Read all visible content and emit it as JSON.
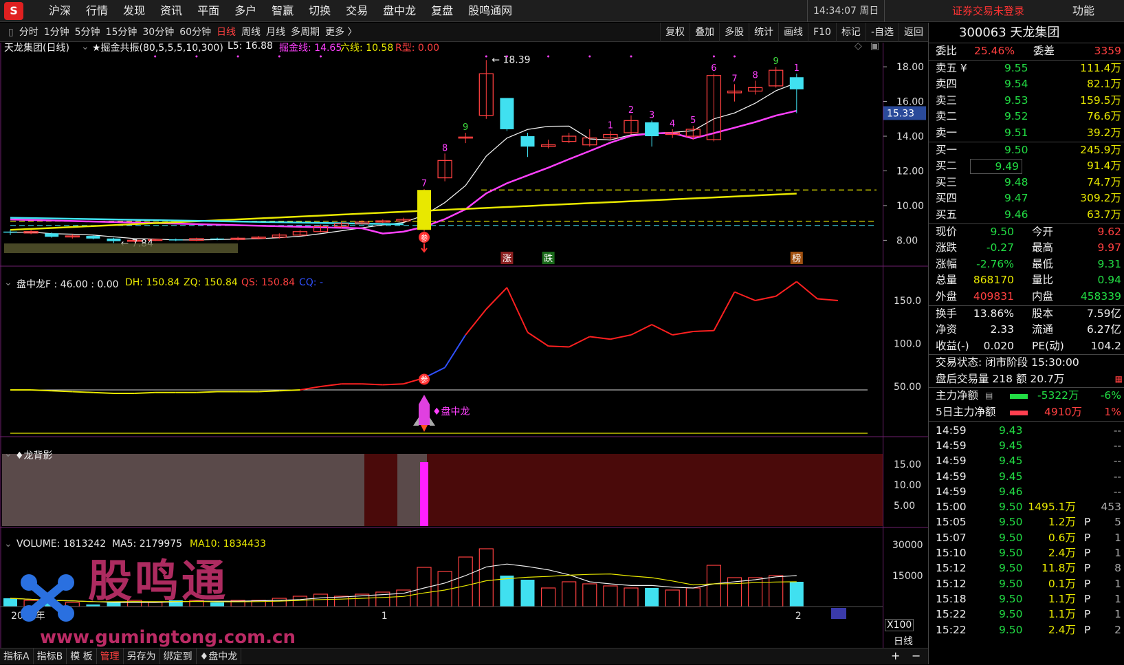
{
  "topbar": {
    "logo": "S",
    "menu": [
      "沪深",
      "行情",
      "发现",
      "资讯",
      "平面",
      "多户",
      "智赢",
      "切换",
      "交易",
      "盘中龙",
      "复盘",
      "股鸣通网"
    ],
    "clock": "14:34:07 周日",
    "not_logged": "证券交易未登录",
    "func": "功能"
  },
  "periodbar": {
    "periods": [
      "分时",
      "1分钟",
      "5分钟",
      "15分钟",
      "30分钟",
      "60分钟",
      "日线",
      "周线",
      "月线",
      "多周期",
      "更多 〉"
    ],
    "active": "日线",
    "tools": [
      "复权",
      "叠加",
      "多股",
      "统计",
      "画线",
      "F10",
      "标记",
      "-自选",
      "返回"
    ]
  },
  "main_chart": {
    "header_title": "天龙集团(日线)",
    "indicator_name": "★掘金共振(80,5,5,5,10,300)",
    "l5": "L5: 16.88",
    "jj": "掘金线: 14.65",
    "lx": "六线: 10.58",
    "r": "R型: 0.00",
    "y_ticks": [
      "18.00",
      "16.00",
      "14.00",
      "12.00",
      "10.00",
      "8.00"
    ],
    "current_price": "15.33",
    "high_label": "18.39",
    "low_label": "7.84",
    "markers": {
      "zhang": "涨",
      "die": "跌",
      "bang": "榜"
    },
    "signal": "参"
  },
  "sub1": {
    "header": "盘中龙F : 46.00 : 0.00",
    "dh": "DH: 150.84",
    "zq": "ZQ: 150.84",
    "qs": "QS: 150.84",
    "cq": "CQ: -",
    "y_ticks": [
      "150.0",
      "100.0",
      "50.00"
    ],
    "rocket_label": "♦盘中龙"
  },
  "sub2": {
    "header": "♦龙背影",
    "y_ticks": [
      "15.00",
      "10.00",
      "5.00"
    ]
  },
  "sub3": {
    "header": "VOLUME: 1813242",
    "ma5": "MA5: 2179975",
    "ma10": "MA10: 1834433",
    "y_ticks": [
      "30000",
      "15000"
    ],
    "unit": "X100",
    "x_labels": [
      "2025年",
      "1",
      "2"
    ],
    "period": "日线",
    "watermark_name": "股鸣通",
    "watermark_url": "www.gumingtong.com.cn"
  },
  "bottombar": {
    "tabs": [
      "指标A",
      "指标B",
      "模 板",
      "管理",
      "另存为",
      "绑定到",
      "♦盘中龙"
    ],
    "active": "管理",
    "plus": "+",
    "minus": "−"
  },
  "quote": {
    "title": "300063 天龙集团",
    "weibi_label": "委比",
    "weibi": "25.46%",
    "weicha_label": "委差",
    "weicha": "3359",
    "asks": [
      {
        "label": "卖五 ¥",
        "price": "9.55",
        "vol": "111.4万"
      },
      {
        "label": "卖四",
        "price": "9.54",
        "vol": "82.1万"
      },
      {
        "label": "卖三",
        "price": "9.53",
        "vol": "159.5万"
      },
      {
        "label": "卖二",
        "price": "9.52",
        "vol": "76.6万"
      },
      {
        "label": "卖一",
        "price": "9.51",
        "vol": "39.2万"
      }
    ],
    "bids": [
      {
        "label": "买一",
        "price": "9.50",
        "vol": "245.9万"
      },
      {
        "label": "买二",
        "price": "9.49",
        "vol": "91.4万"
      },
      {
        "label": "买三",
        "price": "9.48",
        "vol": "74.7万"
      },
      {
        "label": "买四",
        "price": "9.47",
        "vol": "309.2万"
      },
      {
        "label": "买五",
        "price": "9.46",
        "vol": "63.7万"
      }
    ],
    "stats": [
      {
        "l1": "现价",
        "v1": "9.50",
        "c1": "green",
        "l2": "今开",
        "v2": "9.62",
        "c2": "red"
      },
      {
        "l1": "涨跌",
        "v1": "-0.27",
        "c1": "green",
        "l2": "最高",
        "v2": "9.97",
        "c2": "red"
      },
      {
        "l1": "涨幅",
        "v1": "-2.76%",
        "c1": "green",
        "l2": "最低",
        "v2": "9.31",
        "c2": "green"
      },
      {
        "l1": "总量",
        "v1": "868170",
        "c1": "yellow",
        "l2": "量比",
        "v2": "0.94",
        "c2": "green"
      },
      {
        "l1": "外盘",
        "v1": "409831",
        "c1": "red",
        "l2": "内盘",
        "v2": "458339",
        "c2": "green"
      }
    ],
    "stats2": [
      {
        "l1": "换手",
        "v1": "13.86%",
        "l2": "股本",
        "v2": "7.59亿"
      },
      {
        "l1": "净资",
        "v1": "2.33",
        "l2": "流通",
        "v2": "6.27亿"
      },
      {
        "l1": "收益(-)",
        "v1": "0.020",
        "l2": "PE(动)",
        "v2": "104.2"
      }
    ],
    "status": "交易状态: 闭市阶段 15:30:00",
    "after_hours": "盘后交易量 218 额 20.7万",
    "main_net_label": "主力净额",
    "main_net": "-5322万",
    "main_net_pct": "-6%",
    "five_day_label": "5日主力净额",
    "five_day": "4910万",
    "five_day_pct": "1%",
    "ticks": [
      {
        "t": "14:59",
        "p": "9.43",
        "v": "",
        "f": "",
        "n": "--"
      },
      {
        "t": "14:59",
        "p": "9.45",
        "v": "",
        "f": "",
        "n": "--"
      },
      {
        "t": "14:59",
        "p": "9.45",
        "v": "",
        "f": "",
        "n": "--"
      },
      {
        "t": "14:59",
        "p": "9.45",
        "v": "",
        "f": "",
        "n": "--"
      },
      {
        "t": "14:59",
        "p": "9.46",
        "v": "",
        "f": "",
        "n": "--"
      },
      {
        "t": "15:00",
        "p": "9.50",
        "v": "1495.1万",
        "f": "",
        "n": "453"
      },
      {
        "t": "15:05",
        "p": "9.50",
        "v": "1.2万",
        "f": "P",
        "n": "5"
      },
      {
        "t": "15:07",
        "p": "9.50",
        "v": "0.6万",
        "f": "P",
        "n": "1"
      },
      {
        "t": "15:10",
        "p": "9.50",
        "v": "2.4万",
        "f": "P",
        "n": "1"
      },
      {
        "t": "15:12",
        "p": "9.50",
        "v": "11.8万",
        "f": "P",
        "n": "8"
      },
      {
        "t": "15:12",
        "p": "9.50",
        "v": "0.1万",
        "f": "P",
        "n": "1"
      },
      {
        "t": "15:18",
        "p": "9.50",
        "v": "1.1万",
        "f": "P",
        "n": "1"
      },
      {
        "t": "15:22",
        "p": "9.50",
        "v": "1.1万",
        "f": "P",
        "n": "1"
      },
      {
        "t": "15:22",
        "p": "9.50",
        "v": "2.4万",
        "f": "P",
        "n": "2"
      }
    ]
  },
  "chart_data": {
    "type": "candlestick",
    "candles": [
      {
        "o": 8.5,
        "c": 8.45,
        "h": 8.6,
        "l": 8.3
      },
      {
        "o": 8.42,
        "c": 8.5,
        "h": 8.6,
        "l": 8.35
      },
      {
        "o": 8.4,
        "c": 8.2,
        "h": 8.45,
        "l": 8.15
      },
      {
        "o": 8.2,
        "c": 8.25,
        "h": 8.35,
        "l": 8.1
      },
      {
        "o": 8.25,
        "c": 8.1,
        "h": 8.3,
        "l": 8.05
      },
      {
        "o": 8.1,
        "c": 7.95,
        "h": 8.15,
        "l": 7.84
      },
      {
        "o": 7.95,
        "c": 8.0,
        "h": 8.05,
        "l": 7.9
      },
      {
        "o": 8.0,
        "c": 8.05,
        "h": 8.1,
        "l": 7.95
      },
      {
        "o": 8.05,
        "c": 8.0,
        "h": 8.1,
        "l": 7.95
      },
      {
        "o": 8.0,
        "c": 8.1,
        "h": 8.15,
        "l": 7.95
      },
      {
        "o": 8.1,
        "c": 8.05,
        "h": 8.15,
        "l": 8.0
      },
      {
        "o": 8.05,
        "c": 8.12,
        "h": 8.2,
        "l": 8.0
      },
      {
        "o": 8.12,
        "c": 8.18,
        "h": 8.25,
        "l": 8.05
      },
      {
        "o": 8.18,
        "c": 8.3,
        "h": 8.4,
        "l": 8.1
      },
      {
        "o": 8.3,
        "c": 8.5,
        "h": 8.6,
        "l": 8.25
      },
      {
        "o": 8.5,
        "c": 8.8,
        "h": 8.9,
        "l": 8.45
      },
      {
        "o": 8.8,
        "c": 8.95,
        "h": 9.05,
        "l": 8.7
      },
      {
        "o": 8.95,
        "c": 9.05,
        "h": 9.15,
        "l": 8.9
      },
      {
        "o": 9.05,
        "c": 9.12,
        "h": 9.2,
        "l": 9.0
      },
      {
        "o": 9.12,
        "c": 9.2,
        "h": 9.3,
        "l": 9.05
      },
      {
        "o": 8.6,
        "c": 10.9,
        "h": 10.95,
        "l": 8.5
      },
      {
        "o": 11.6,
        "c": 12.6,
        "h": 13.0,
        "l": 11.4
      },
      {
        "o": 13.9,
        "c": 13.95,
        "h": 14.2,
        "l": 13.6
      },
      {
        "o": 15.2,
        "c": 17.6,
        "h": 18.39,
        "l": 15.0
      },
      {
        "o": 16.2,
        "c": 14.4,
        "h": 16.2,
        "l": 14.3
      },
      {
        "o": 14.0,
        "c": 13.4,
        "h": 14.2,
        "l": 12.8
      },
      {
        "o": 13.4,
        "c": 13.5,
        "h": 13.8,
        "l": 13.3
      },
      {
        "o": 13.7,
        "c": 14.0,
        "h": 14.2,
        "l": 13.6
      },
      {
        "o": 13.5,
        "c": 13.9,
        "h": 14.4,
        "l": 13.4
      },
      {
        "o": 13.9,
        "c": 14.1,
        "h": 14.3,
        "l": 13.8
      },
      {
        "o": 14.2,
        "c": 14.9,
        "h": 15.2,
        "l": 14.1
      },
      {
        "o": 14.8,
        "c": 14.0,
        "h": 14.9,
        "l": 13.4
      },
      {
        "o": 14.1,
        "c": 14.2,
        "h": 14.4,
        "l": 13.9
      },
      {
        "o": 14.0,
        "c": 14.4,
        "h": 14.6,
        "l": 13.8
      },
      {
        "o": 13.8,
        "c": 17.5,
        "h": 17.6,
        "l": 13.7
      },
      {
        "o": 16.5,
        "c": 16.6,
        "h": 17.0,
        "l": 16.0
      },
      {
        "o": 16.6,
        "c": 16.8,
        "h": 17.2,
        "l": 16.4
      },
      {
        "o": 16.9,
        "c": 17.8,
        "h": 18.0,
        "l": 16.8
      },
      {
        "o": 17.4,
        "c": 16.7,
        "h": 17.6,
        "l": 15.33
      }
    ],
    "ylim": [
      7.5,
      18.6
    ],
    "volumes": [
      4,
      3,
      2,
      2,
      1,
      2,
      3,
      2,
      3,
      3,
      2,
      3,
      3,
      4,
      5,
      6,
      5,
      6,
      7,
      8,
      19,
      17,
      24,
      28,
      15,
      13,
      9,
      12,
      11,
      10,
      9,
      9,
      8,
      9,
      20,
      14,
      14,
      15,
      12
    ],
    "panzhonglong": [
      46,
      46,
      45,
      44,
      43,
      42,
      42,
      43,
      43,
      43,
      44,
      44,
      44,
      45,
      46,
      50,
      53,
      53,
      52,
      53,
      60,
      72,
      110,
      140,
      165,
      113,
      97,
      96,
      108,
      105,
      110,
      122,
      110,
      114,
      115,
      160,
      150,
      155,
      172,
      152,
      150
    ]
  }
}
